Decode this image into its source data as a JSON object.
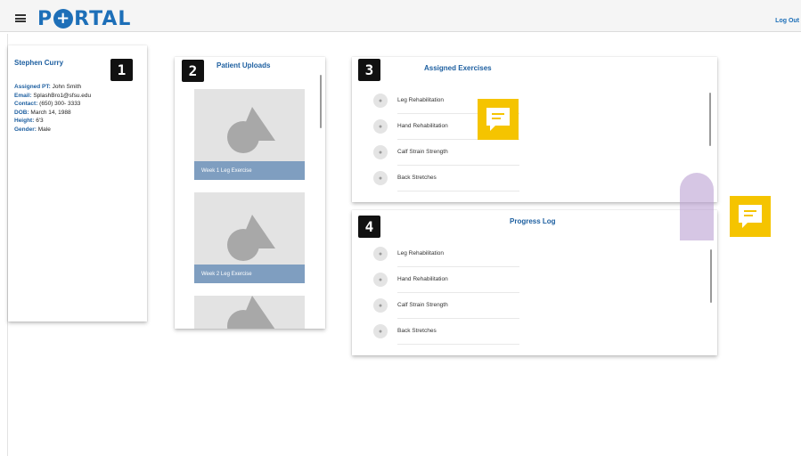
{
  "header": {
    "logo_prefix": "P",
    "logo_suffix": "RTAL",
    "logout_label": "Log Out"
  },
  "patient": {
    "name": "Stephen Curry",
    "badge": "1",
    "fields": [
      {
        "label": "Assigned PT:",
        "value": "John Smith"
      },
      {
        "label": "Email:",
        "value": "SplashBro1@sfsu.edu"
      },
      {
        "label": "Contact:",
        "value": "(650) 300- 3333"
      },
      {
        "label": "DOB:",
        "value": "March 14, 1988"
      },
      {
        "label": "Height:",
        "value": "6'3"
      },
      {
        "label": "Gender:",
        "value": "Male"
      }
    ]
  },
  "uploads": {
    "badge": "2",
    "title": "Patient Uploads",
    "items": [
      {
        "caption": "Week 1 Leg Exercise"
      },
      {
        "caption": "Week 2 Leg Exercise"
      },
      {
        "caption": ""
      }
    ]
  },
  "assigned": {
    "badge": "3",
    "title": "Assigned Exercises",
    "items": [
      "Leg Rehabilitation",
      "Hand Rehabilitation",
      "Calf Strain Strength",
      "Back Stretches"
    ]
  },
  "progress": {
    "badge": "4",
    "title": "Progress Log",
    "items": [
      "Leg Rehabilitation",
      "Hand Rehabilitation",
      "Calf Strain Strength",
      "Back Stretches"
    ]
  },
  "icons": {
    "menu": "hamburger-icon",
    "exercise": "dumbbell-icon",
    "comment": "comment-icon",
    "image_placeholder": "image-placeholder-icon"
  },
  "colors": {
    "brand": "#1d6fb8",
    "comment": "#f5c400",
    "caption_bar": "#7f9ec0"
  }
}
